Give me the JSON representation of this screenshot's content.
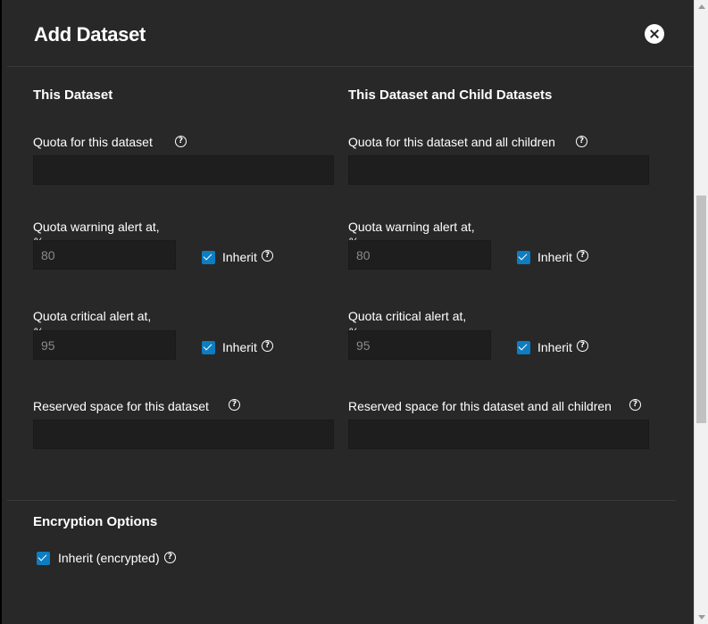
{
  "dialog": {
    "title": "Add Dataset",
    "close_icon": "close-circle-icon"
  },
  "this_dataset": {
    "heading": "This Dataset",
    "quota_label": "Quota for this dataset",
    "quota_value": "",
    "warning_label": "Quota warning alert at,",
    "warning_unit": "%",
    "warning_placeholder": "80",
    "warning_inherit_label": "Inherit",
    "warning_inherit_checked": true,
    "critical_label": "Quota critical alert at,",
    "critical_unit": "%",
    "critical_placeholder": "95",
    "critical_inherit_label": "Inherit",
    "critical_inherit_checked": true,
    "reserved_label": "Reserved space for this dataset",
    "reserved_value": ""
  },
  "child_datasets": {
    "heading": "This Dataset and Child Datasets",
    "quota_label": "Quota for this dataset and all children",
    "quota_value": "",
    "warning_label": "Quota warning alert at,",
    "warning_unit": "%",
    "warning_placeholder": "80",
    "warning_inherit_label": "Inherit",
    "warning_inherit_checked": true,
    "critical_label": "Quota critical alert at,",
    "critical_unit": "%",
    "critical_placeholder": "95",
    "critical_inherit_label": "Inherit",
    "critical_inherit_checked": true,
    "reserved_label": "Reserved space for this dataset and all children",
    "reserved_value": ""
  },
  "encryption": {
    "heading": "Encryption Options",
    "inherit_label": "Inherit (encrypted)",
    "inherit_checked": true
  },
  "icons": {
    "help": "?",
    "help_name": "help-circle-icon"
  },
  "colors": {
    "panel_bg": "#282828",
    "input_bg": "#1e1e1e",
    "checkbox_accent": "#0d7dc1",
    "text": "#ffffff"
  }
}
